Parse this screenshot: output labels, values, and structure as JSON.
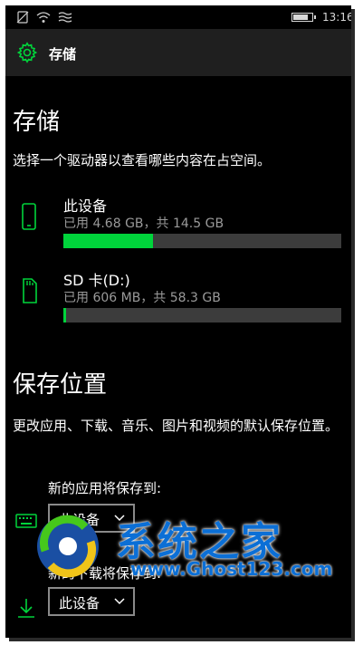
{
  "status": {
    "time": "13:16",
    "battery_level": 0.8,
    "icons": [
      "no-sim-icon",
      "wifi-icon",
      "signal-icon"
    ]
  },
  "header": {
    "title": "存储",
    "icon": "gear-icon",
    "accent": "#00d43b"
  },
  "storage": {
    "heading": "存储",
    "description": "选择一个驱动器以查看哪些内容在占空间。",
    "drives": [
      {
        "name": "此设备",
        "usage": "已用 4.68 GB，共 14.5 GB",
        "fill_fraction": 0.323,
        "icon": "phone-icon"
      },
      {
        "name": "SD 卡(D:)",
        "usage": "已用 606 MB，共 58.3 GB",
        "fill_fraction": 0.01,
        "icon": "sd-card-icon"
      }
    ]
  },
  "save_locations": {
    "heading": "保存位置",
    "description": "更改应用、下载、音乐、图片和视频的默认保存位置。",
    "apps": {
      "label": "新的应用将保存到:",
      "value": "此设备",
      "icon": "keyboard-icon"
    },
    "downloads": {
      "label": "新的下载将保存到:",
      "value": "此设备",
      "icon": "download-icon"
    }
  },
  "watermark": {
    "title": "系统之家",
    "url": "www.Ghost123.com"
  }
}
